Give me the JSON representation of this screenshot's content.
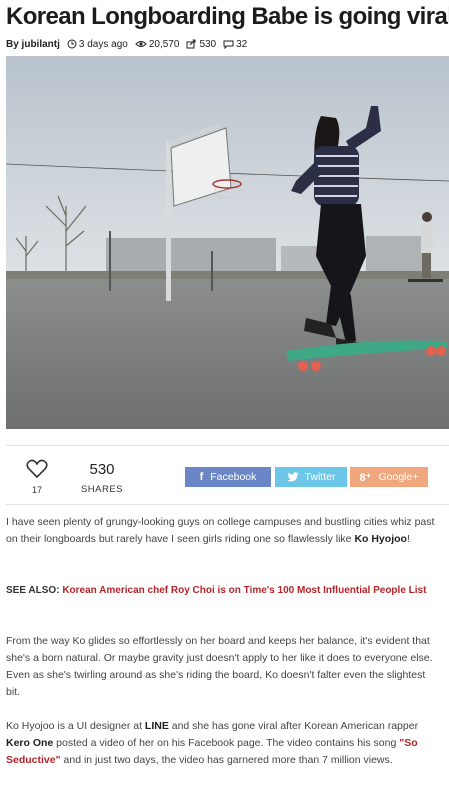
{
  "article": {
    "title": "Korean Longboarding Babe is going viral!",
    "meta": {
      "author": "By jubilantj",
      "time": "3 days ago",
      "views": "20,570",
      "shares": "530",
      "comments": "32"
    }
  },
  "share_bar": {
    "likes": "17",
    "share_count": "530",
    "shares_label": "SHARES",
    "facebook": {
      "icon": "f",
      "label": "Facebook"
    },
    "twitter": {
      "label": "Twitter"
    },
    "google": {
      "icon": "8⁺",
      "label": "Google+"
    }
  },
  "body": {
    "p1_text": "I have seen plenty of grungy-looking guys on college campuses and bustling cities whiz past on their longboards but rarely have I seen girls riding one so flawlessly like ",
    "p1_bold": "Ko Hyojoo",
    "p1_end": "!",
    "see_also_label": "SEE ALSO:",
    "see_also_link": "Korean American chef Roy Choi is on Time's 100 Most Influential People List",
    "p2": "From the way Ko glides so effortlessly on her board and keeps her balance, it's evident that she's a born natural. Or maybe gravity just doesn't apply to her like it does to everyone else. Even as she's twirling around as she's riding the board, Ko doesn't falter even the slightest bit.",
    "p3_a": "Ko Hyojoo is a UI designer at ",
    "p3_line": "LINE",
    "p3_b": " and she has gone viral after Korean American rapper ",
    "p3_kero": "Kero One",
    "p3_c": " posted a video of her on his Facebook page. The video contains his song ",
    "p3_song": "\"So Seductive\"",
    "p3_d": " and in just two days, the video has garnered more than 7 million views."
  },
  "colors": {
    "facebook": "#6b86c6",
    "twitter": "#6cc6e8",
    "google": "#f0a77e",
    "link_red": "#b4252a"
  },
  "icons": [
    "clock-icon",
    "eye-icon",
    "share-icon",
    "comment-icon",
    "heart-icon",
    "twitter-bird-icon"
  ]
}
